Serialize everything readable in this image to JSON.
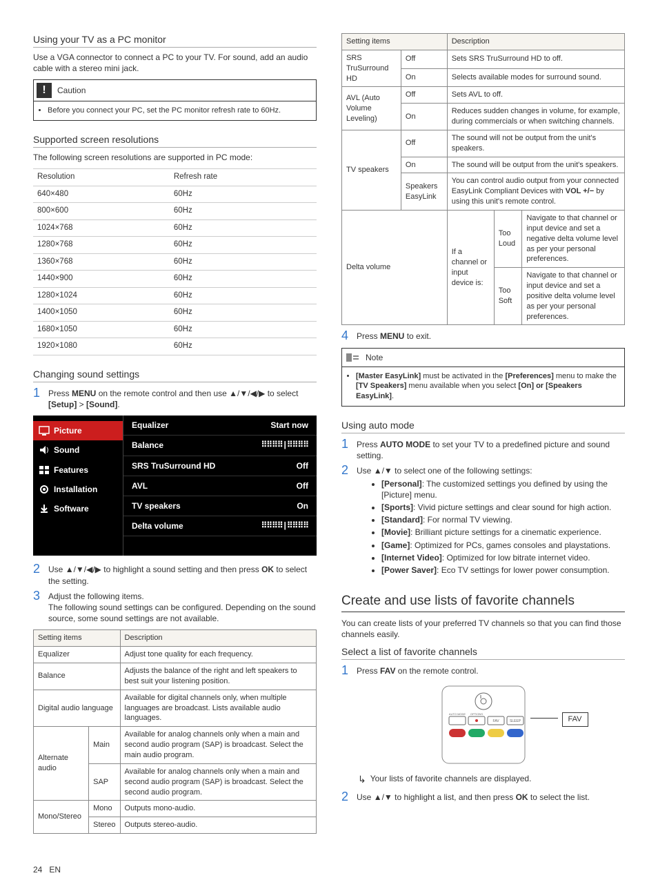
{
  "left": {
    "pc_monitor": {
      "heading": "Using your TV as a PC monitor",
      "body": "Use a VGA connector to connect a PC to your TV. For sound, add an audio cable with a stereo mini jack.",
      "caution_title": "Caution",
      "caution_item": "Before you connect your PC, set the PC monitor refresh rate to 60Hz."
    },
    "resolutions": {
      "heading": "Supported screen resolutions",
      "intro": "The following screen resolutions are supported in PC mode:",
      "col_res": "Resolution",
      "col_rate": "Refresh rate",
      "rows": [
        {
          "res": "640×480",
          "rate": "60Hz"
        },
        {
          "res": "800×600",
          "rate": "60Hz"
        },
        {
          "res": "1024×768",
          "rate": "60Hz"
        },
        {
          "res": "1280×768",
          "rate": "60Hz"
        },
        {
          "res": "1360×768",
          "rate": "60Hz"
        },
        {
          "res": "1440×900",
          "rate": "60Hz"
        },
        {
          "res": "1280×1024",
          "rate": "60Hz"
        },
        {
          "res": "1400×1050",
          "rate": "60Hz"
        },
        {
          "res": "1680×1050",
          "rate": "60Hz"
        },
        {
          "res": "1920×1080",
          "rate": "60Hz"
        }
      ]
    },
    "sound": {
      "heading": "Changing sound settings",
      "step1_a": "Press ",
      "step1_menu": "MENU",
      "step1_b": " on the remote control and then use ",
      "step1_arrows": "▲/▼/◀/▶",
      "step1_c": " to select ",
      "step1_setup": "[Setup]",
      "step1_gt": " > ",
      "step1_sound": "[Sound]",
      "step1_end": ".",
      "menu": {
        "items": [
          "Picture",
          "Sound",
          "Features",
          "Installation",
          "Software"
        ],
        "rows": [
          {
            "lbl": "Equalizer",
            "val": "Start now"
          },
          {
            "lbl": "Balance",
            "val": "⠿⠿⠿⠿|⠿⠿⠿⠿"
          },
          {
            "lbl": "SRS TruSurround HD",
            "val": "Off"
          },
          {
            "lbl": "AVL",
            "val": "Off"
          },
          {
            "lbl": "TV speakers",
            "val": "On"
          },
          {
            "lbl": "Delta volume",
            "val": "⠿⠿⠿⠿|⠿⠿⠿⠿"
          }
        ]
      },
      "step2_a": "Use ",
      "step2_arrows": "▲/▼/◀/▶",
      "step2_b": " to highlight a sound setting and then press ",
      "step2_ok": "OK",
      "step2_c": " to select the setting.",
      "step3_a": "Adjust the following items.",
      "step3_b": "The following sound settings can be configured. Depending on the sound source, some sound settings are not available.",
      "table": {
        "h1": "Setting items",
        "h2": "Description",
        "r1_a": "Equalizer",
        "r1_b": "Adjust tone quality for each frequency.",
        "r2_a": "Balance",
        "r2_b": "Adjusts the balance of the right and left speakers to best suit your listening position.",
        "r3_a": "Digital audio language",
        "r3_b": "Available for digital channels only, when multiple languages are broadcast. Lists available audio languages.",
        "r4_a": "Alternate audio",
        "r4_b": "Main",
        "r4_c": "Available for analog channels only when a main and second audio program (SAP) is broadcast. Select the main audio program.",
        "r4_d": "SAP",
        "r4_e": "Available for analog channels only when a main and second audio program (SAP) is broadcast. Select the second audio program.",
        "r5_a": "Mono/Stereo",
        "r5_b": "Mono",
        "r5_c": "Outputs mono-audio.",
        "r5_d": "Stereo",
        "r5_e": "Outputs stereo-audio."
      }
    }
  },
  "right": {
    "table2": {
      "h1": "Setting items",
      "h2": "Description",
      "srs": "SRS TruSurround HD",
      "srs_off": "Off",
      "srs_off_d": "Sets SRS TruSurround HD to off.",
      "srs_on": "On",
      "srs_on_d": "Selects available modes for surround sound.",
      "avl": "AVL (Auto Volume Leveling)",
      "avl_off": "Off",
      "avl_off_d": "Sets AVL to off.",
      "avl_on": "On",
      "avl_on_d": "Reduces sudden changes in volume, for example, during commercials or when switching channels.",
      "tvsp": "TV speakers",
      "tvsp_off": "Off",
      "tvsp_off_d": "The sound will not be output from the unit's speakers.",
      "tvsp_on": "On",
      "tvsp_on_d": "The sound will be output from the unit's speakers.",
      "tvsp_el": "Speakers EasyLink",
      "tvsp_el_a": "You can control audio output from your connected EasyLink Compliant Devices with ",
      "tvsp_el_vol": "VOL +/−",
      "tvsp_el_b": " by using this unit's remote control.",
      "dv": "Delta volume",
      "dv_intro": "If a channel or input device is:",
      "dv_loud": "Too Loud",
      "dv_loud_d": "Navigate to that channel or input device and set a negative delta volume level as per your personal preferences.",
      "dv_soft": "Too Soft",
      "dv_soft_d": "Navigate to that channel or input device and set a positive delta volume level as per your personal preferences."
    },
    "step4_a": "Press ",
    "step4_menu": "MENU",
    "step4_b": " to exit.",
    "note_title": "Note",
    "note_a": "[Master EasyLink]",
    "note_b": " must be activated in the ",
    "note_c": "[Preferences]",
    "note_d": " menu to make the ",
    "note_e": "[TV Speakers]",
    "note_f": " menu available when you select ",
    "note_g": "[On] or [Speakers EasyLink]",
    "note_h": ".",
    "auto": {
      "heading": "Using auto mode",
      "s1_a": "Press ",
      "s1_b": "AUTO MODE",
      "s1_c": " to set your TV to a predefined picture and sound setting.",
      "s2_a": "Use ",
      "s2_arrows": "▲/▼",
      "s2_b": " to select one of the following settings:",
      "items": [
        {
          "k": "[Personal]",
          "v": ": The customized settings you defined by using the [Picture] menu."
        },
        {
          "k": "[Sports]",
          "v": ": Vivid picture settings and clear sound for high action."
        },
        {
          "k": "[Standard]",
          "v": ": For normal TV viewing."
        },
        {
          "k": "[Movie]",
          "v": ": Brilliant picture settings for a cinematic experience."
        },
        {
          "k": "[Game]",
          "v": ": Optimized for PCs, games consoles and playstations."
        },
        {
          "k": "[Internet Video]",
          "v": ": Optimized for low bitrate internet video."
        },
        {
          "k": "[Power Saver]",
          "v": ": Eco TV settings for lower power consumption."
        }
      ]
    },
    "fav": {
      "h2": "Create and use lists of favorite channels",
      "intro": "You can create lists of your preferred TV channels so that you can find those channels easily.",
      "h3": "Select a list of favorite channels",
      "s1_a": "Press ",
      "s1_b": "FAV",
      "s1_c": " on the remote control.",
      "label_fav": "FAV",
      "result": "Your lists of favorite channels are displayed.",
      "s2_a": "Use ",
      "s2_arrows": "▲/▼",
      "s2_b": " to highlight a list, and then press ",
      "s2_ok": "OK",
      "s2_c": " to select the list."
    },
    "remote_btns": {
      "auto": "AUTO MODE",
      "options": "OPTIONS",
      "fav": "FAV",
      "sleep": "SLEEP"
    }
  },
  "page": {
    "num": "24",
    "lang": "EN"
  }
}
